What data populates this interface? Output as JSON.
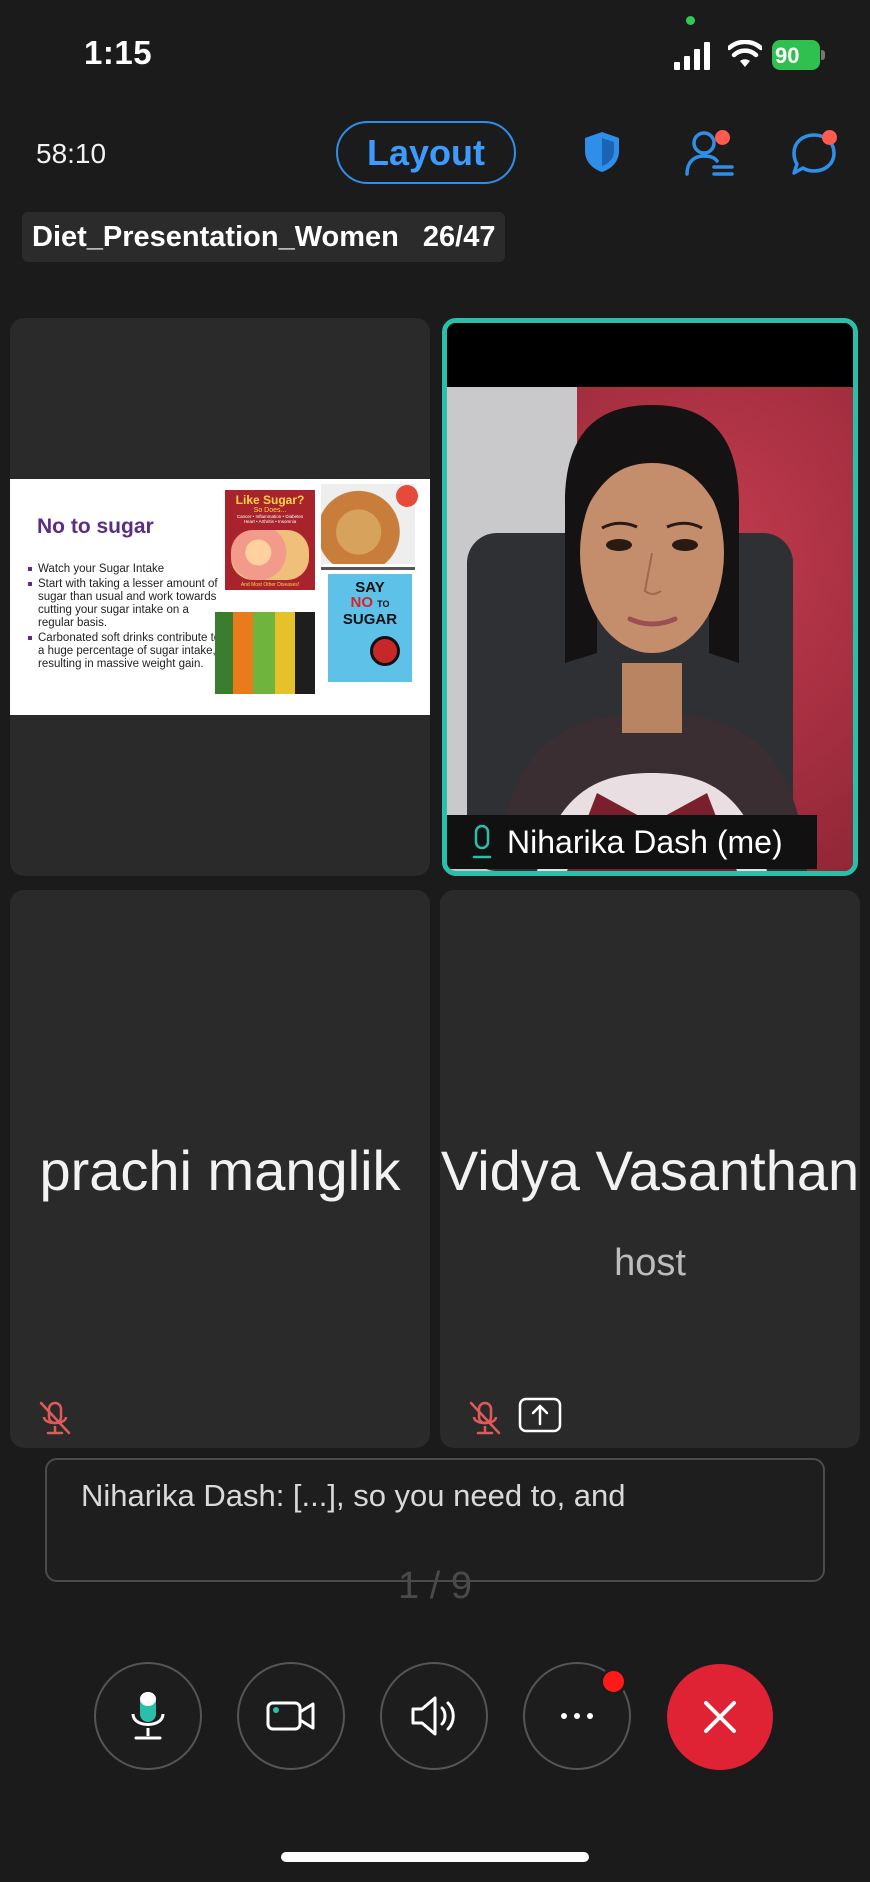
{
  "status_bar": {
    "time": "1:15",
    "battery": "90"
  },
  "top_bar": {
    "timer": "58:10",
    "layout_label": "Layout"
  },
  "presentation": {
    "name": "Diet_Presentation_Women",
    "page": "26/47"
  },
  "slide": {
    "title": "No to sugar",
    "bullets": [
      "Watch your Sugar Intake",
      "Start with taking a lesser amount of sugar than usual and work towards cutting your sugar intake on a regular basis.",
      "Carbonated soft drinks contribute to a huge percentage of sugar intake, resulting in massive weight gain."
    ],
    "image_texts": {
      "like_sugar": "Like Sugar?",
      "so_does": "So Does...",
      "diseases": "Cancer • Inflammation • Diabetes\nHeart • Arthritis • Insomnia",
      "other_diseases": "And Most Other Diseases!",
      "say": "SAY",
      "no": "NO",
      "to": "TO",
      "sugar": "SUGAR"
    }
  },
  "participants": {
    "self_name": "Niharika Dash (me)",
    "p2_name": "prachi manglik",
    "p3_name": "Vidya Vasanthan",
    "p3_role": "host"
  },
  "caption": {
    "text": "Niharika Dash: [...], so you need to, and"
  },
  "caption_page": "1 / 9",
  "colors": {
    "accent": "#2f8fe8",
    "active_border": "#2bbfaa",
    "end_call": "#e02235",
    "muted_mic": "#e05a5a"
  }
}
